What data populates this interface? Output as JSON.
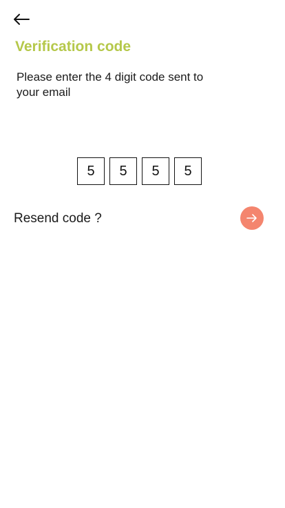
{
  "header": {
    "back_icon": "arrow-left-icon",
    "title": "Verification code"
  },
  "instructions": "Please enter the 4 digit code sent to your email",
  "code": {
    "digits": [
      "5",
      "5",
      "5",
      "5"
    ]
  },
  "footer": {
    "resend_label": "Resend code ?",
    "next_icon": "arrow-right-icon"
  },
  "colors": {
    "title": "#b5c84a",
    "next_button": "#f4856e"
  }
}
